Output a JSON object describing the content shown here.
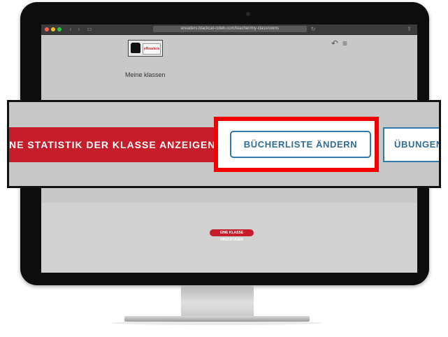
{
  "browser": {
    "address": "ereaders.blackcat-cideb.com/teacher/my-classrooms",
    "back_glyph": "‹",
    "forward_glyph": "›",
    "reload_glyph": "↻",
    "share_glyph": "⇪"
  },
  "site": {
    "logo_text": "eReaders"
  },
  "header": {
    "back_glyph": "↶",
    "menu_glyph": "≡"
  },
  "page": {
    "title": "Meine klassen",
    "add_class_button": "EINE KLASSE HINZUFÜGEN"
  },
  "zoom": {
    "stat_button": "NE STATISTIK DER KLASSE ANZEIGEN",
    "books_button": "BÜCHERLISTE ÄNDERN",
    "exercises_button": "ÜBUNGEN Z"
  },
  "colors": {
    "brand_red": "#c51d2a",
    "highlight_red": "#f40000",
    "accent_blue": "#2f7aaa"
  }
}
